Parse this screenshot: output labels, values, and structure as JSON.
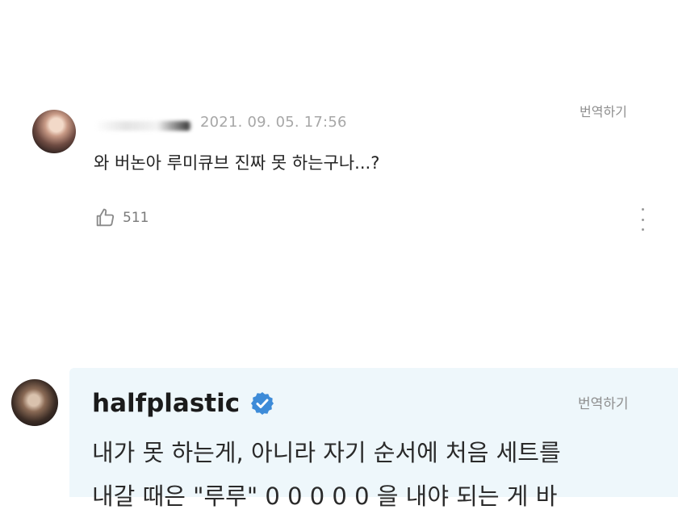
{
  "comment": {
    "timestamp": "2021. 09. 05. 17:56",
    "translate_label": "번역하기",
    "text": "와 버논아 루미큐브 진짜 못 하는구나...?",
    "like_count": "511",
    "icons": {
      "like": "thumbs-up-icon",
      "more": "more-vertical-icon"
    }
  },
  "reply": {
    "author": "halfplastic",
    "verified_icon": "verified-badge-icon",
    "translate_label": "번역하기",
    "text_line1": "내가 못 하는게, 아니라 자기 순서에 처음 세트를",
    "text_line2": "내갈 때은 \"루루\" 0 0 0 0 0 을 내야 되는 게 바"
  },
  "colors": {
    "reply_background": "#eef7fb",
    "verified_blue": "#3d8bd8",
    "muted_text": "#8e8e8e"
  }
}
